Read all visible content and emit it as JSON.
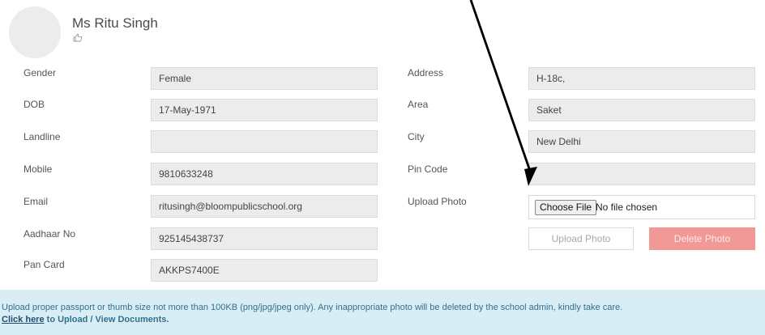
{
  "profile": {
    "name": "Ms Ritu Singh",
    "avatar_icon": "avatar-placeholder",
    "thumb_icon": "thumbs-up-icon"
  },
  "left_fields": [
    {
      "label": "Gender",
      "value": "Female"
    },
    {
      "label": "DOB",
      "value": "17-May-1971"
    },
    {
      "label": "Landline",
      "value": ""
    },
    {
      "label": "Mobile",
      "value": "9810633248"
    },
    {
      "label": "Email",
      "value": "ritusingh@bloompublicschool.org"
    },
    {
      "label": "Aadhaar No",
      "value": "925145438737"
    },
    {
      "label": "Pan Card",
      "value": "AKKPS7400E"
    }
  ],
  "right_fields": [
    {
      "label": "Address",
      "value": "H-18c,"
    },
    {
      "label": "Area",
      "value": "Saket"
    },
    {
      "label": "City",
      "value": "New Delhi"
    },
    {
      "label": "Pin Code",
      "value": ""
    }
  ],
  "upload": {
    "label": "Upload Photo",
    "choose_button": "Choose File",
    "file_status": "No file chosen",
    "upload_button": "Upload Photo",
    "delete_button": "Delete Photo"
  },
  "notice": {
    "text": "Upload proper passport or thumb size not more than 100KB (png/jpg/jpeg only). Any inappropriate photo will be deleted by the school admin, kindly take care.",
    "link_text": "Click here",
    "link_suffix": " to Upload / View Documents."
  },
  "colors": {
    "delete_button": "#f19996",
    "notice_background": "#d9edf4",
    "field_background": "#ececec"
  }
}
